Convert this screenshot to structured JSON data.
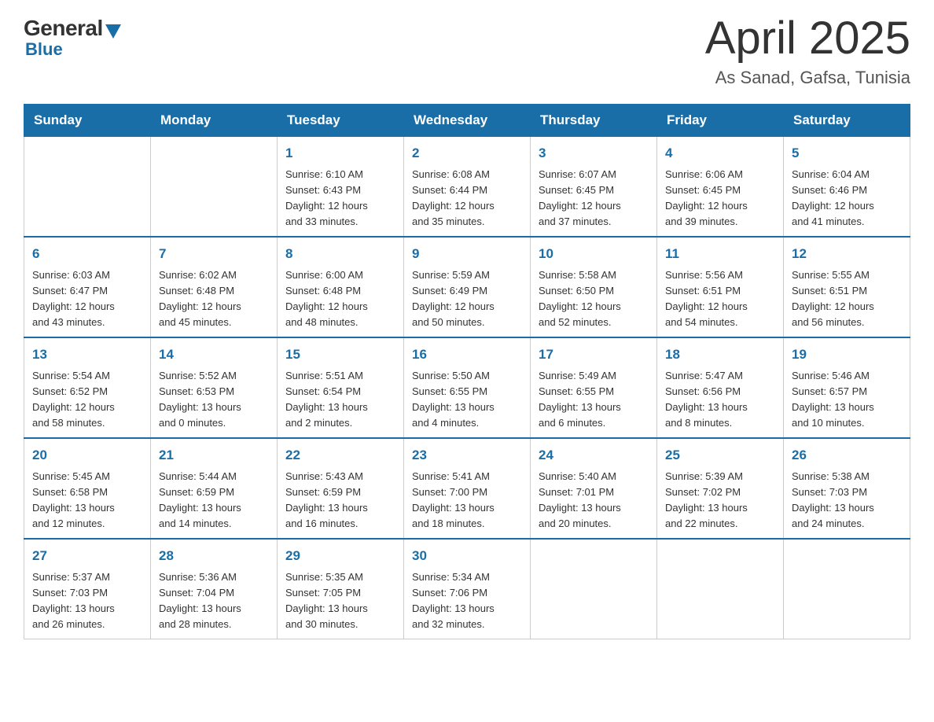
{
  "header": {
    "logo_general": "General",
    "logo_blue": "Blue",
    "month": "April 2025",
    "location": "As Sanad, Gafsa, Tunisia"
  },
  "days_of_week": [
    "Sunday",
    "Monday",
    "Tuesday",
    "Wednesday",
    "Thursday",
    "Friday",
    "Saturday"
  ],
  "weeks": [
    [
      {
        "day": "",
        "info": ""
      },
      {
        "day": "",
        "info": ""
      },
      {
        "day": "1",
        "info": "Sunrise: 6:10 AM\nSunset: 6:43 PM\nDaylight: 12 hours\nand 33 minutes."
      },
      {
        "day": "2",
        "info": "Sunrise: 6:08 AM\nSunset: 6:44 PM\nDaylight: 12 hours\nand 35 minutes."
      },
      {
        "day": "3",
        "info": "Sunrise: 6:07 AM\nSunset: 6:45 PM\nDaylight: 12 hours\nand 37 minutes."
      },
      {
        "day": "4",
        "info": "Sunrise: 6:06 AM\nSunset: 6:45 PM\nDaylight: 12 hours\nand 39 minutes."
      },
      {
        "day": "5",
        "info": "Sunrise: 6:04 AM\nSunset: 6:46 PM\nDaylight: 12 hours\nand 41 minutes."
      }
    ],
    [
      {
        "day": "6",
        "info": "Sunrise: 6:03 AM\nSunset: 6:47 PM\nDaylight: 12 hours\nand 43 minutes."
      },
      {
        "day": "7",
        "info": "Sunrise: 6:02 AM\nSunset: 6:48 PM\nDaylight: 12 hours\nand 45 minutes."
      },
      {
        "day": "8",
        "info": "Sunrise: 6:00 AM\nSunset: 6:48 PM\nDaylight: 12 hours\nand 48 minutes."
      },
      {
        "day": "9",
        "info": "Sunrise: 5:59 AM\nSunset: 6:49 PM\nDaylight: 12 hours\nand 50 minutes."
      },
      {
        "day": "10",
        "info": "Sunrise: 5:58 AM\nSunset: 6:50 PM\nDaylight: 12 hours\nand 52 minutes."
      },
      {
        "day": "11",
        "info": "Sunrise: 5:56 AM\nSunset: 6:51 PM\nDaylight: 12 hours\nand 54 minutes."
      },
      {
        "day": "12",
        "info": "Sunrise: 5:55 AM\nSunset: 6:51 PM\nDaylight: 12 hours\nand 56 minutes."
      }
    ],
    [
      {
        "day": "13",
        "info": "Sunrise: 5:54 AM\nSunset: 6:52 PM\nDaylight: 12 hours\nand 58 minutes."
      },
      {
        "day": "14",
        "info": "Sunrise: 5:52 AM\nSunset: 6:53 PM\nDaylight: 13 hours\nand 0 minutes."
      },
      {
        "day": "15",
        "info": "Sunrise: 5:51 AM\nSunset: 6:54 PM\nDaylight: 13 hours\nand 2 minutes."
      },
      {
        "day": "16",
        "info": "Sunrise: 5:50 AM\nSunset: 6:55 PM\nDaylight: 13 hours\nand 4 minutes."
      },
      {
        "day": "17",
        "info": "Sunrise: 5:49 AM\nSunset: 6:55 PM\nDaylight: 13 hours\nand 6 minutes."
      },
      {
        "day": "18",
        "info": "Sunrise: 5:47 AM\nSunset: 6:56 PM\nDaylight: 13 hours\nand 8 minutes."
      },
      {
        "day": "19",
        "info": "Sunrise: 5:46 AM\nSunset: 6:57 PM\nDaylight: 13 hours\nand 10 minutes."
      }
    ],
    [
      {
        "day": "20",
        "info": "Sunrise: 5:45 AM\nSunset: 6:58 PM\nDaylight: 13 hours\nand 12 minutes."
      },
      {
        "day": "21",
        "info": "Sunrise: 5:44 AM\nSunset: 6:59 PM\nDaylight: 13 hours\nand 14 minutes."
      },
      {
        "day": "22",
        "info": "Sunrise: 5:43 AM\nSunset: 6:59 PM\nDaylight: 13 hours\nand 16 minutes."
      },
      {
        "day": "23",
        "info": "Sunrise: 5:41 AM\nSunset: 7:00 PM\nDaylight: 13 hours\nand 18 minutes."
      },
      {
        "day": "24",
        "info": "Sunrise: 5:40 AM\nSunset: 7:01 PM\nDaylight: 13 hours\nand 20 minutes."
      },
      {
        "day": "25",
        "info": "Sunrise: 5:39 AM\nSunset: 7:02 PM\nDaylight: 13 hours\nand 22 minutes."
      },
      {
        "day": "26",
        "info": "Sunrise: 5:38 AM\nSunset: 7:03 PM\nDaylight: 13 hours\nand 24 minutes."
      }
    ],
    [
      {
        "day": "27",
        "info": "Sunrise: 5:37 AM\nSunset: 7:03 PM\nDaylight: 13 hours\nand 26 minutes."
      },
      {
        "day": "28",
        "info": "Sunrise: 5:36 AM\nSunset: 7:04 PM\nDaylight: 13 hours\nand 28 minutes."
      },
      {
        "day": "29",
        "info": "Sunrise: 5:35 AM\nSunset: 7:05 PM\nDaylight: 13 hours\nand 30 minutes."
      },
      {
        "day": "30",
        "info": "Sunrise: 5:34 AM\nSunset: 7:06 PM\nDaylight: 13 hours\nand 32 minutes."
      },
      {
        "day": "",
        "info": ""
      },
      {
        "day": "",
        "info": ""
      },
      {
        "day": "",
        "info": ""
      }
    ]
  ]
}
